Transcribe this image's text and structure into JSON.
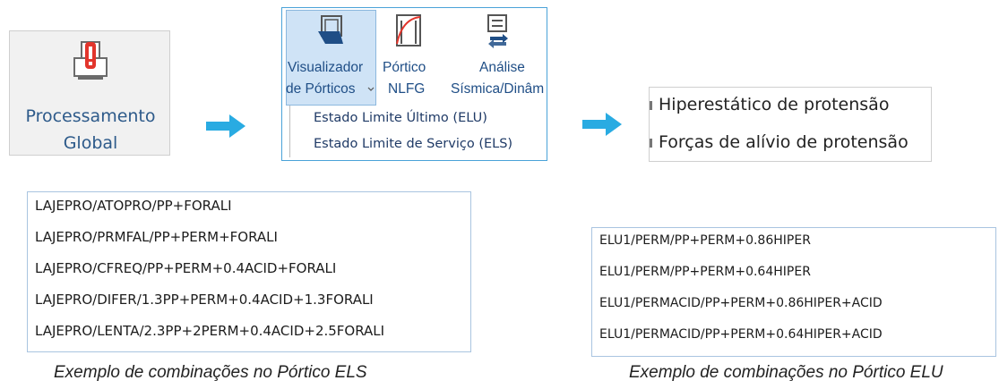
{
  "global_button": {
    "label_line1": "Processamento",
    "label_line2": "Global",
    "icon": "building-alert-icon"
  },
  "ribbon": {
    "visualizador_line1": "Visualizador",
    "visualizador_line2": "de Pórticos",
    "portico_line1": "Pórtico",
    "portico_line2": "NLFG",
    "analise_line1": "Análise",
    "analise_line2": "Sísmica/Dinâm",
    "menu": [
      "Estado Limite Último (ELU)",
      "Estado Limite de Serviço (ELS)"
    ]
  },
  "protensao_menu": [
    "Hiperestático de protensão",
    "Forças de alívio de protensão"
  ],
  "els_combos": [
    "LAJEPRO/ATOPRO/PP+FORALI",
    "LAJEPRO/PRMFAL/PP+PERM+FORALI",
    "LAJEPRO/CFREQ/PP+PERM+0.4ACID+FORALI",
    "LAJEPRO/DIFER/1.3PP+PERM+0.4ACID+1.3FORALI",
    "LAJEPRO/LENTA/2.3PP+2PERM+0.4ACID+2.5FORALI"
  ],
  "elu_combos": [
    "ELU1/PERM/PP+PERM+0.86HIPER",
    "ELU1/PERM/PP+PERM+0.64HIPER",
    "ELU1/PERMACID/PP+PERM+0.86HIPER+ACID",
    "ELU1/PERMACID/PP+PERM+0.64HIPER+ACID"
  ],
  "captions": {
    "els": "Exemplo de combinações no Pórtico ELS",
    "elu": "Exemplo de combinações no Pórtico ELU"
  },
  "colors": {
    "accent": "#29abe2",
    "ribbon_border": "#4aa3d8",
    "label_blue": "#1f4e86"
  }
}
